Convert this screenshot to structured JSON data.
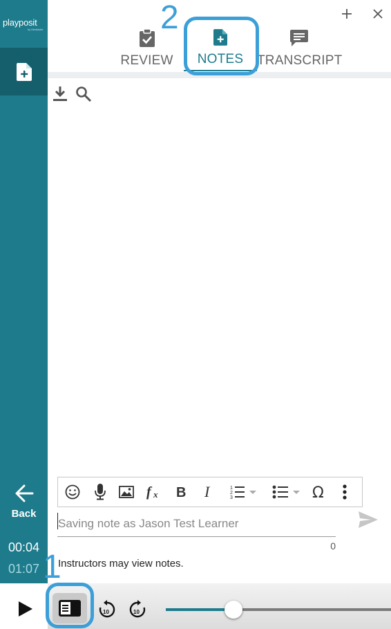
{
  "app": {
    "logo_text": "playposit",
    "logo_subtext": "by Mediasite"
  },
  "window": {
    "add_icon": "plus-icon",
    "close_icon": "close-icon"
  },
  "tabs": [
    {
      "label": "REVIEW",
      "icon": "clipboard-check-icon",
      "active": false
    },
    {
      "label": "NOTES",
      "icon": "file-plus-icon",
      "active": true
    },
    {
      "label": "TRANSCRIPT",
      "icon": "chat-lines-icon",
      "active": false
    }
  ],
  "tools": {
    "download_icon": "download-icon",
    "search_icon": "search-icon"
  },
  "sidebar": {
    "active_tab_icon": "file-plus-icon",
    "back_label": "Back",
    "current_time": "00:04",
    "total_time": "01:07"
  },
  "editor": {
    "toolbar": [
      "emoji-icon",
      "microphone-icon",
      "image-icon",
      "formula-icon",
      "bold-icon",
      "italic-icon",
      "ordered-list-icon",
      "bullet-list-icon",
      "omega-icon",
      "more-vertical-icon"
    ],
    "placeholder": "Saving note as Jason Test Learner",
    "value": "",
    "char_count": "0",
    "notice": "Instructors may view notes."
  },
  "player": {
    "progress": 0.3,
    "rewind_label": "10",
    "forward_label": "10"
  },
  "callouts": {
    "one": "1",
    "two": "2"
  },
  "colors": {
    "accent": "#1d7b8c",
    "callout": "#3c9fd8"
  }
}
